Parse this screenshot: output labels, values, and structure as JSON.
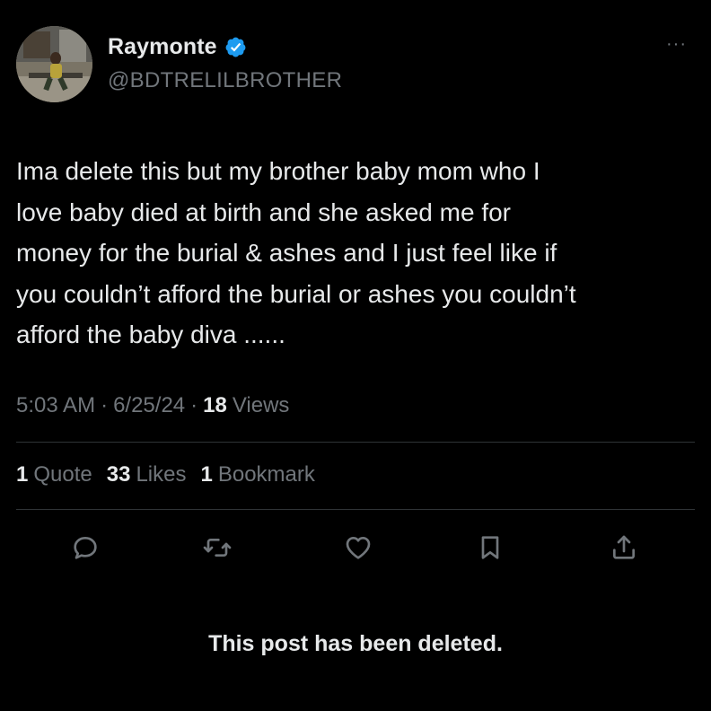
{
  "author": {
    "display_name": "Raymonte",
    "handle": "@BDTRELILBROTHER"
  },
  "post": {
    "text": "Ima delete this but my brother baby mom who I\nlove baby died at birth and she asked me for\nmoney for the burial & ashes and I just feel like if\nyou couldn’t afford the burial or ashes you couldn’t\nafford the baby diva ......",
    "time": "5:03 AM",
    "date": "6/25/24",
    "separator": "·",
    "views_count": "18",
    "views_label": "Views"
  },
  "stats": {
    "quotes_count": "1",
    "quotes_label": "Quote",
    "likes_count": "33",
    "likes_label": "Likes",
    "bookmarks_count": "1",
    "bookmarks_label": "Bookmark"
  },
  "more_menu": "···",
  "actions": [
    "reply-icon",
    "repost-icon",
    "like-icon",
    "bookmark-icon",
    "share-icon"
  ],
  "deleted_notice": "This post has been deleted.",
  "colors": {
    "background": "#000000",
    "primary_text": "#e7e9ea",
    "secondary_text": "#71767b",
    "divider": "#2f3336",
    "verified": "#1d9bf0"
  }
}
